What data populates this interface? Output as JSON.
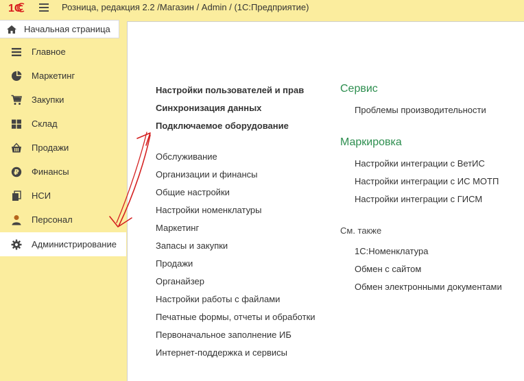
{
  "title_bar": {
    "logo_text": "1С",
    "title": "Розница, редакция 2.2 /Магазин / Admin /  (1С:Предприятие)"
  },
  "home_tab": {
    "label": "Начальная страница",
    "icon": "home-icon"
  },
  "sidebar": {
    "items": [
      {
        "label": "Главное",
        "icon": "menu-lines-icon",
        "active": false
      },
      {
        "label": "Маркетинг",
        "icon": "pie-chart-icon",
        "active": false
      },
      {
        "label": "Закупки",
        "icon": "cart-icon",
        "active": false
      },
      {
        "label": "Склад",
        "icon": "warehouse-grid-icon",
        "active": false
      },
      {
        "label": "Продажи",
        "icon": "basket-icon",
        "active": false
      },
      {
        "label": "Финансы",
        "icon": "ruble-coin-icon",
        "active": false
      },
      {
        "label": "НСИ",
        "icon": "documents-icon",
        "active": false
      },
      {
        "label": "Персонал",
        "icon": "person-icon",
        "active": false
      },
      {
        "label": "Администрирование",
        "icon": "gear-icon",
        "active": true
      }
    ]
  },
  "main": {
    "bold_links": [
      "Настройки пользователей и прав",
      "Синхронизация данных",
      "Подключаемое оборудование"
    ],
    "links": [
      "Обслуживание",
      "Организации и финансы",
      "Общие настройки",
      "Настройки номенклатуры",
      "Маркетинг",
      "Запасы и закупки",
      "Продажи",
      "Органайзер",
      "Настройки работы с файлами",
      "Печатные формы, отчеты и обработки",
      "Первоначальное заполнение ИБ",
      "Интернет-поддержка и сервисы"
    ],
    "service": {
      "title": "Сервис",
      "items": [
        "Проблемы производительности"
      ]
    },
    "marking": {
      "title": "Маркировка",
      "items": [
        "Настройки интеграции с ВетИС",
        "Настройки интеграции с ИС МОТП",
        "Настройки интеграции с ГИСМ"
      ]
    },
    "see_also": {
      "title": "См. также",
      "items": [
        "1С:Номенклатура",
        "Обмен с сайтом",
        "Обмен электронными документами"
      ]
    }
  },
  "colors": {
    "background": "#fbed9e",
    "section_title": "#2d8e4f",
    "logo": "#d81e1e",
    "annotation": "#d42020"
  }
}
